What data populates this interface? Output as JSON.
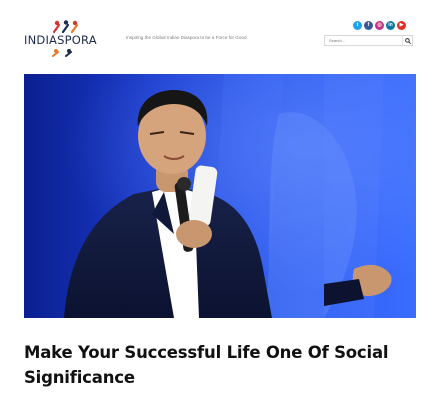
{
  "header": {
    "logo": {
      "text": "INDIASPORA",
      "colors": {
        "red": "#d7322f",
        "blue": "#1d2b4f",
        "orange": "#e9772c"
      }
    },
    "tagline": "Inspiring the Global Indian Diaspora to be a Force for Good",
    "search": {
      "placeholder": "Search...",
      "icon": "search-icon"
    },
    "socials": [
      {
        "name": "twitter-icon",
        "glyph": "t",
        "color": "#1da1f2"
      },
      {
        "name": "facebook-icon",
        "glyph": "f",
        "color": "#3b5998"
      },
      {
        "name": "instagram-icon",
        "glyph": "◎",
        "color": "#c13584"
      },
      {
        "name": "linkedin-icon",
        "glyph": "in",
        "color": "#0e76a8"
      },
      {
        "name": "youtube-icon",
        "glyph": "▶",
        "color": "#e52d27"
      }
    ]
  },
  "article": {
    "title": "Make Your Successful Life One Of Social Significance"
  }
}
